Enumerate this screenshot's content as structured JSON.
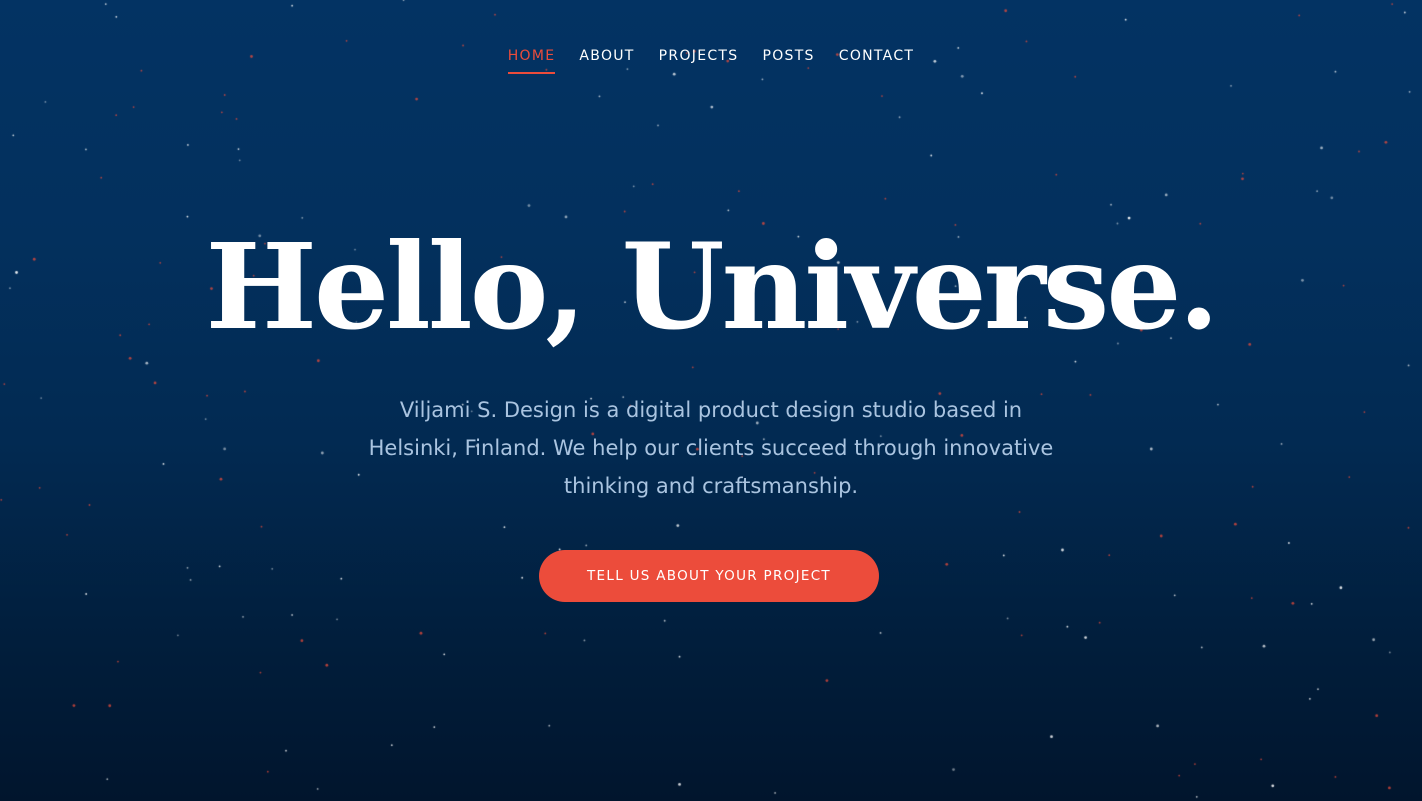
{
  "colors": {
    "background_top": "#033363",
    "background_bottom": "#01152d",
    "accent": "#ec4c3b",
    "text": "#ffffff",
    "muted_text": "#aac4e0"
  },
  "nav": {
    "items": [
      {
        "label": "HOME",
        "active": true
      },
      {
        "label": "ABOUT",
        "active": false
      },
      {
        "label": "PROJECTS",
        "active": false
      },
      {
        "label": "POSTS",
        "active": false
      },
      {
        "label": "CONTACT",
        "active": false
      }
    ]
  },
  "hero": {
    "title": "Hello, Universe.",
    "description": "Viljami S. Design is a digital product design studio based in Helsinki, Finland. We help our clients succeed through innovative thinking and craftsmanship.",
    "cta_label": "TELL US ABOUT YOUR PROJECT"
  }
}
